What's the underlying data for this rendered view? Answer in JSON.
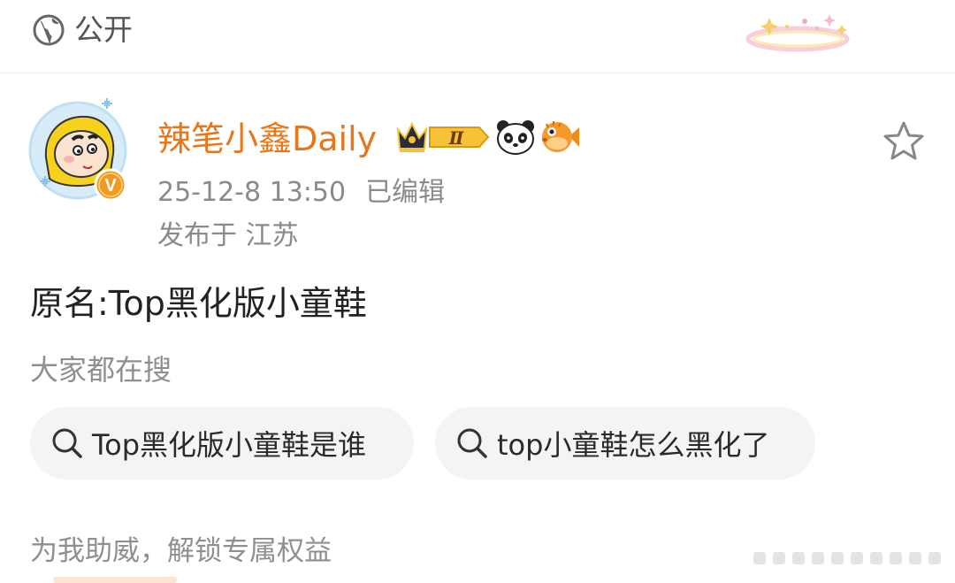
{
  "privacy": {
    "label": "公开",
    "icon": "globe-icon"
  },
  "author": {
    "name": "辣笔小鑫Daily",
    "verified_badge_letter": "V",
    "vip_level": "Ⅱ",
    "icons": [
      "crown-vip-badge-icon",
      "panda-emoji-icon",
      "pufferfish-emoji-icon"
    ],
    "accent_color": "#e8761a"
  },
  "meta": {
    "timestamp": "25-12-8 13:50",
    "edited": "已编辑",
    "location": "发布于 江苏"
  },
  "post": {
    "text": "原名:Top黑化版小童鞋"
  },
  "search": {
    "heading": "大家都在搜",
    "chips": [
      {
        "label": "Top黑化版小童鞋是谁",
        "icon": "search-icon"
      },
      {
        "label": "top小童鞋怎么黑化了",
        "icon": "search-icon"
      }
    ]
  },
  "promo": {
    "text": "为我助威，解锁专属权益"
  },
  "actions": {
    "favorite_icon": "star-outline-icon"
  }
}
